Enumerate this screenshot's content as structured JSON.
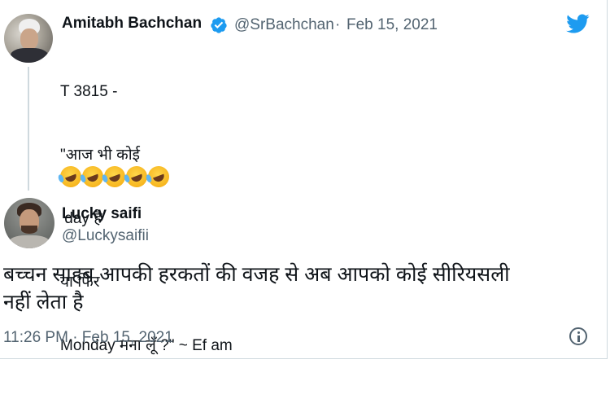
{
  "quoted_tweet": {
    "display_name": "Amitabh Bachchan",
    "handle": "@SrBachchan",
    "separator": "·",
    "date": "Feb 15, 2021",
    "lines": [
      "T 3815 -",
      "\"आज भी कोई",
      " day है",
      "या फिर",
      "Monday मना लूँ ?\" ~ Ef am"
    ],
    "emoji_count": 5,
    "emoji_name": "rolling-on-the-floor-laughing"
  },
  "reply_tweet": {
    "display_name": "Lucky saifi",
    "handle": "@Luckysaifii",
    "text": "बच्चन साहब आपकी हरकतों की वजह से अब आपको कोई सीरियसली\nनहीं लेता है",
    "timestamp": "11:26 PM · Feb 15, 2021"
  },
  "colors": {
    "verified_blue": "#1d9bf0",
    "twitter_blue": "#1d9bf0",
    "secondary_text": "#536471",
    "primary_text": "#0f1419"
  },
  "icons": {
    "verified": "verified-badge-icon",
    "brand": "twitter-bird-icon",
    "info": "info-icon"
  }
}
